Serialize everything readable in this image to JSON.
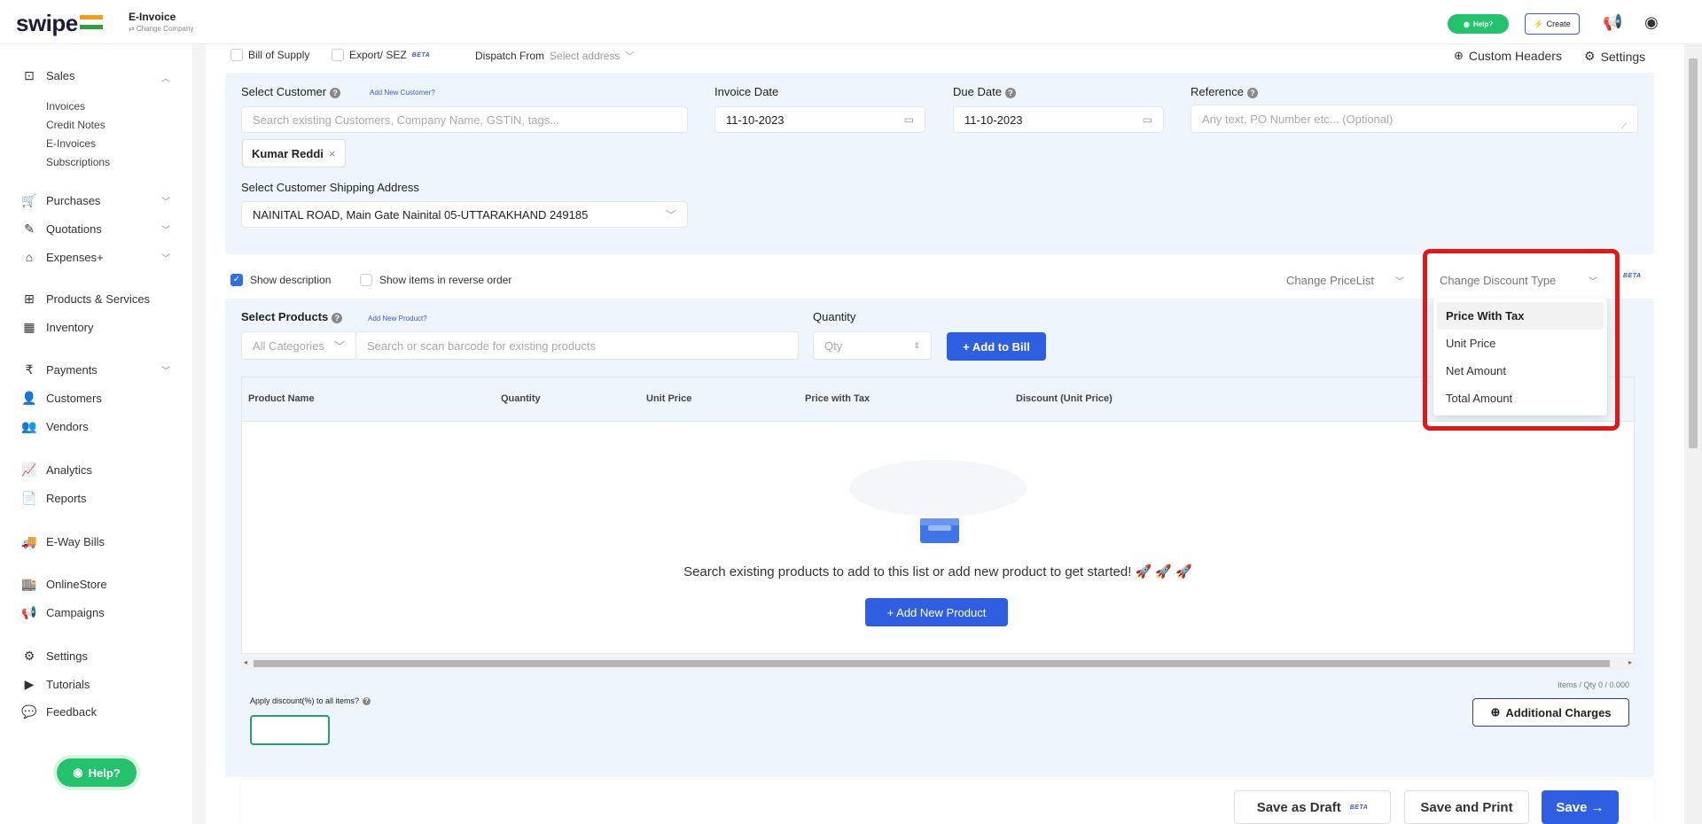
{
  "topbar": {
    "logo": "swipe",
    "doc_type": "E-Invoice",
    "change_company": "⇄ Change Company",
    "help_label": "Help?",
    "create_label": "Create"
  },
  "sidebar": {
    "sales": "Sales",
    "sales_sub": [
      "Invoices",
      "Credit Notes",
      "E-Invoices",
      "Subscriptions"
    ],
    "items": [
      {
        "label": "Purchases"
      },
      {
        "label": "Quotations"
      },
      {
        "label": "Expenses+"
      },
      {
        "label": "Products & Services"
      },
      {
        "label": "Inventory"
      },
      {
        "label": "Payments"
      },
      {
        "label": "Customers"
      },
      {
        "label": "Vendors"
      },
      {
        "label": "Analytics"
      },
      {
        "label": "Reports"
      },
      {
        "label": "E-Way Bills"
      },
      {
        "label": "OnlineStore"
      },
      {
        "label": "Campaigns"
      },
      {
        "label": "Settings"
      },
      {
        "label": "Tutorials"
      },
      {
        "label": "Feedback"
      }
    ],
    "help_label": "Help?"
  },
  "options": {
    "bill_of_supply": "Bill of Supply",
    "export_sez": "Export/ SEZ",
    "beta": "BETA",
    "dispatch_from": "Dispatch From",
    "select_address": "Select address",
    "custom_headers": "Custom Headers",
    "settings": "Settings"
  },
  "customer": {
    "label": "Select Customer",
    "add_new": "Add New Customer?",
    "placeholder": "Search existing Customers, Company Name, GSTIN, tags...",
    "selected": "Kumar Reddi",
    "shipping_label": "Select Customer Shipping Address",
    "shipping_value": "NAINITAL ROAD, Main Gate Nainital 05-UTTARAKHAND 249185"
  },
  "dates": {
    "invoice_label": "Invoice Date",
    "invoice_value": "11-10-2023",
    "due_label": "Due Date",
    "due_value": "11-10-2023"
  },
  "reference": {
    "label": "Reference",
    "placeholder": "Any text, PO Number etc... (Optional)"
  },
  "items_opts": {
    "show_description": "Show description",
    "reverse_order": "Show items in reverse order",
    "change_pricelist": "Change PriceList",
    "change_discount_type": "Change Discount Type"
  },
  "discount_dropdown": {
    "options": [
      "Price With Tax",
      "Unit Price",
      "Net Amount",
      "Total Amount"
    ],
    "selected": "Price With Tax"
  },
  "products": {
    "label": "Select Products",
    "add_new": "Add New Product?",
    "category": "All Categories",
    "search_placeholder": "Search or scan barcode for existing products",
    "quantity_label": "Quantity",
    "qty_placeholder": "Qty",
    "add_to_bill": "+ Add to Bill"
  },
  "table": {
    "columns": [
      "Product Name",
      "Quantity",
      "Unit Price",
      "Price with Tax",
      "Discount (Unit Price)"
    ],
    "empty_message": "Search existing products to add to this list or add new product to get started! 🚀 🚀 🚀",
    "add_new_product": "+ Add New Product",
    "items_qty": "Items / Qty 0 / 0.000"
  },
  "discount_all": {
    "label": "Apply discount(%) to all items?"
  },
  "additional_charges": "Additional Charges",
  "footer": {
    "save_draft": "Save as Draft",
    "save_print": "Save and Print",
    "save": "Save →"
  },
  "colors": {
    "primary": "#2f5fe0",
    "panel": "#eef5fc",
    "help_green": "#25c26e",
    "highlight": "#e01818"
  }
}
